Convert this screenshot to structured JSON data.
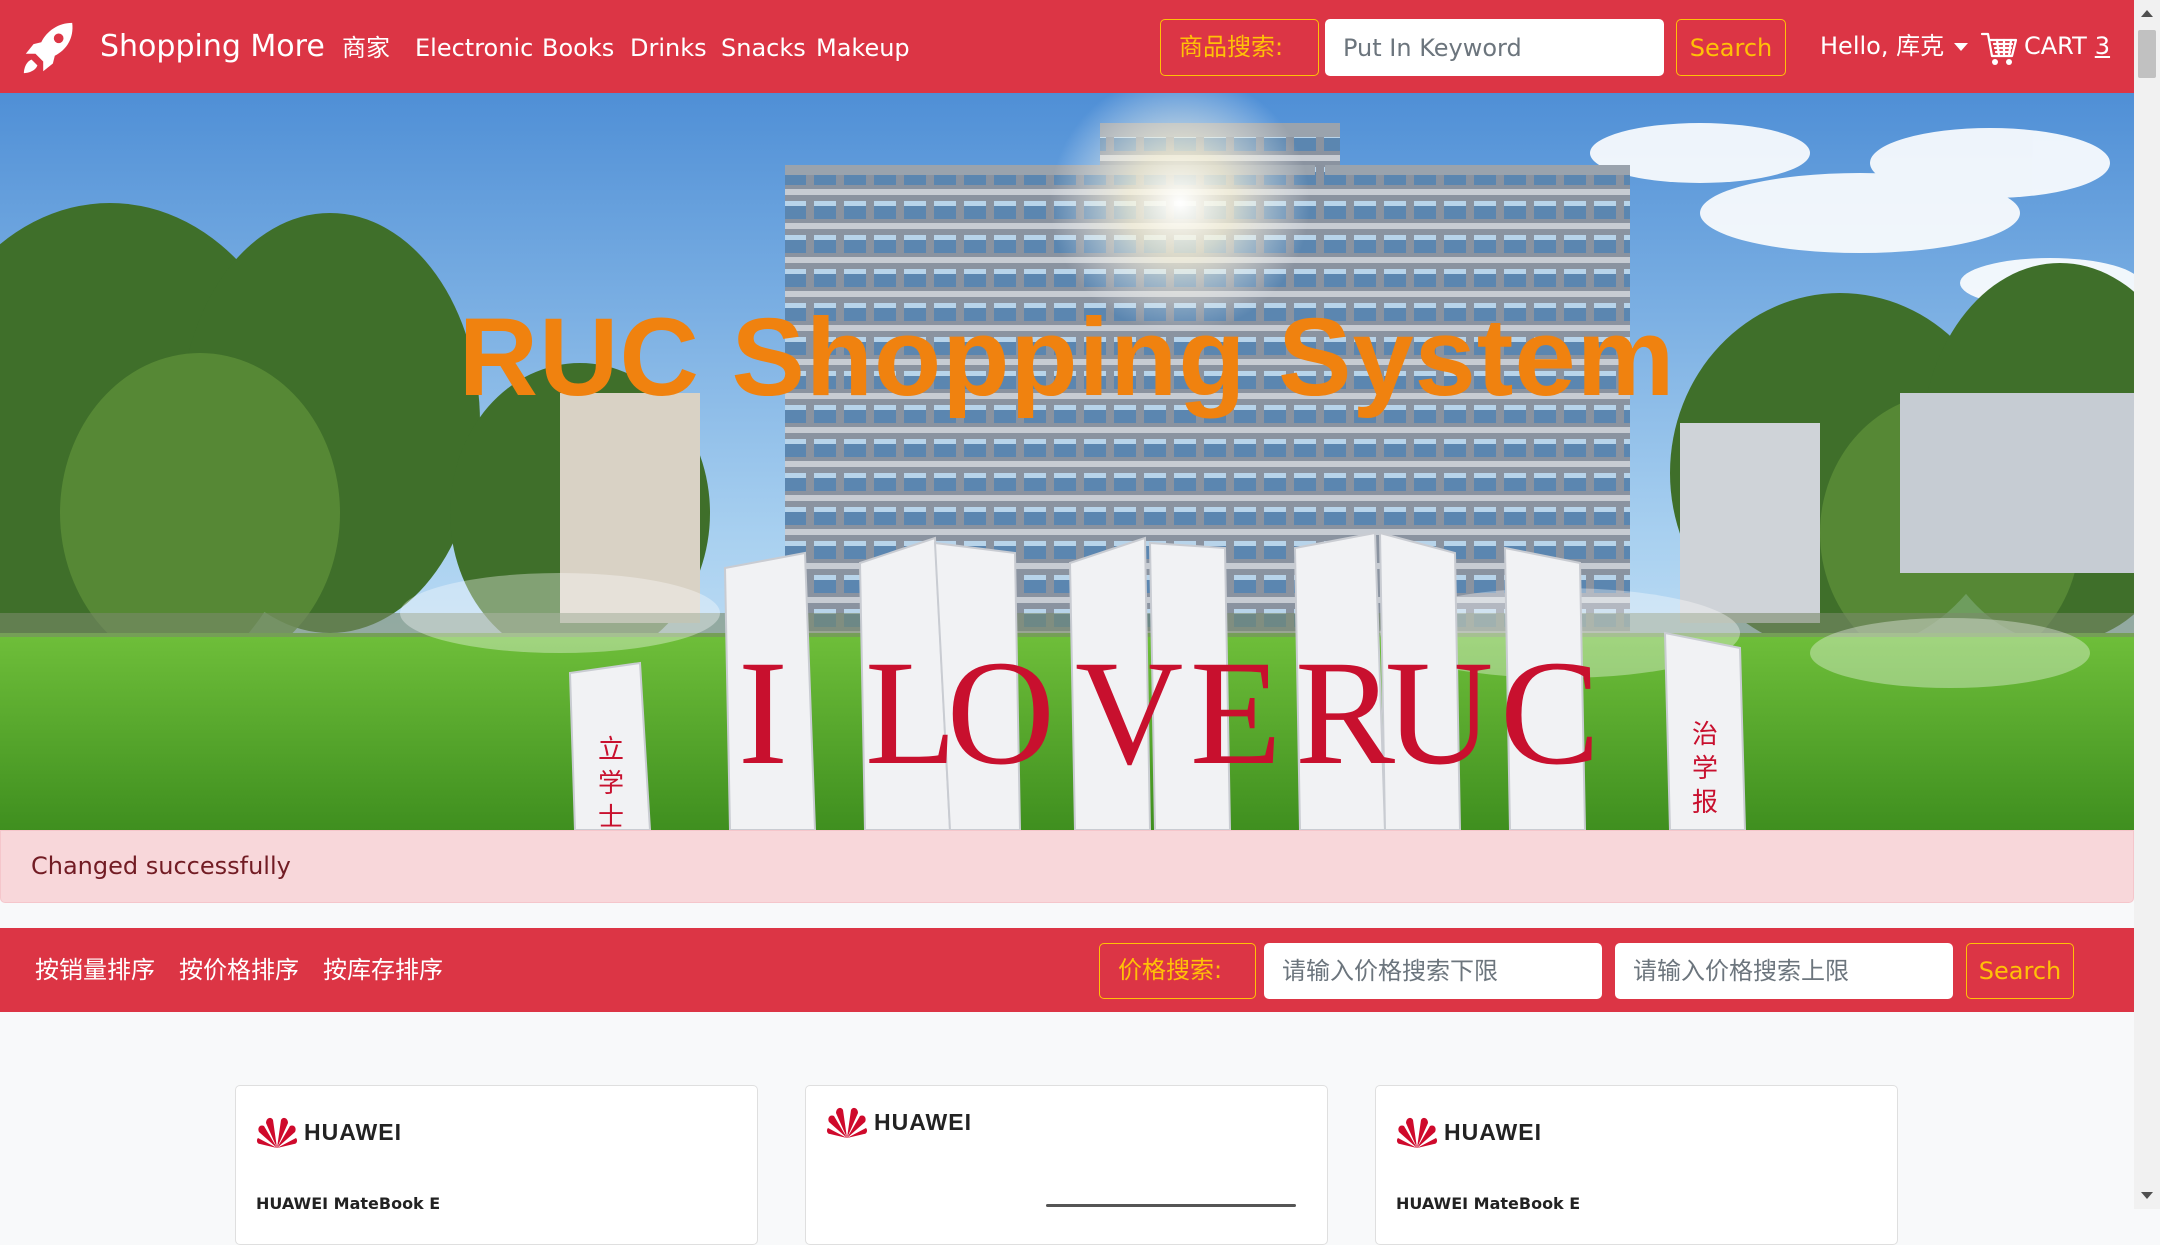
{
  "navbar": {
    "brand": "Shopping More",
    "links": [
      "商家",
      "Electronic",
      "Books",
      "Drinks",
      "Snacks",
      "Makeup"
    ],
    "search_label": "商品搜索:",
    "search_placeholder": "Put In Keyword",
    "search_button": "Search",
    "user_greeting": "Hello, 库克",
    "cart_label": "CART",
    "cart_count": "3"
  },
  "hero": {
    "title": "RUC Shopping System",
    "sculpture_letters": [
      "I",
      "LO",
      "V",
      "E",
      "R",
      "U",
      "C"
    ],
    "left_pillar_text": "立 学 士",
    "right_pillar_text": "治 学 报"
  },
  "alert": {
    "message": "Changed successfully"
  },
  "filter": {
    "sort_links": [
      "按销量排序",
      "按价格排序",
      "按库存排序"
    ],
    "price_label": "价格搜索:",
    "min_placeholder": "请输入价格搜索下限",
    "max_placeholder": "请输入价格搜索上限",
    "search_button": "Search"
  },
  "products": [
    {
      "brand": "HUAWEI",
      "title": "HUAWEI MateBook E"
    },
    {
      "brand": "HUAWEI",
      "title": ""
    },
    {
      "brand": "HUAWEI",
      "title": "HUAWEI MateBook E"
    }
  ],
  "colors": {
    "primary": "#dc3545",
    "accent": "#ffc107",
    "hero_title": "#f0820f",
    "alert_bg": "#f8d7da",
    "alert_text": "#721c24"
  }
}
